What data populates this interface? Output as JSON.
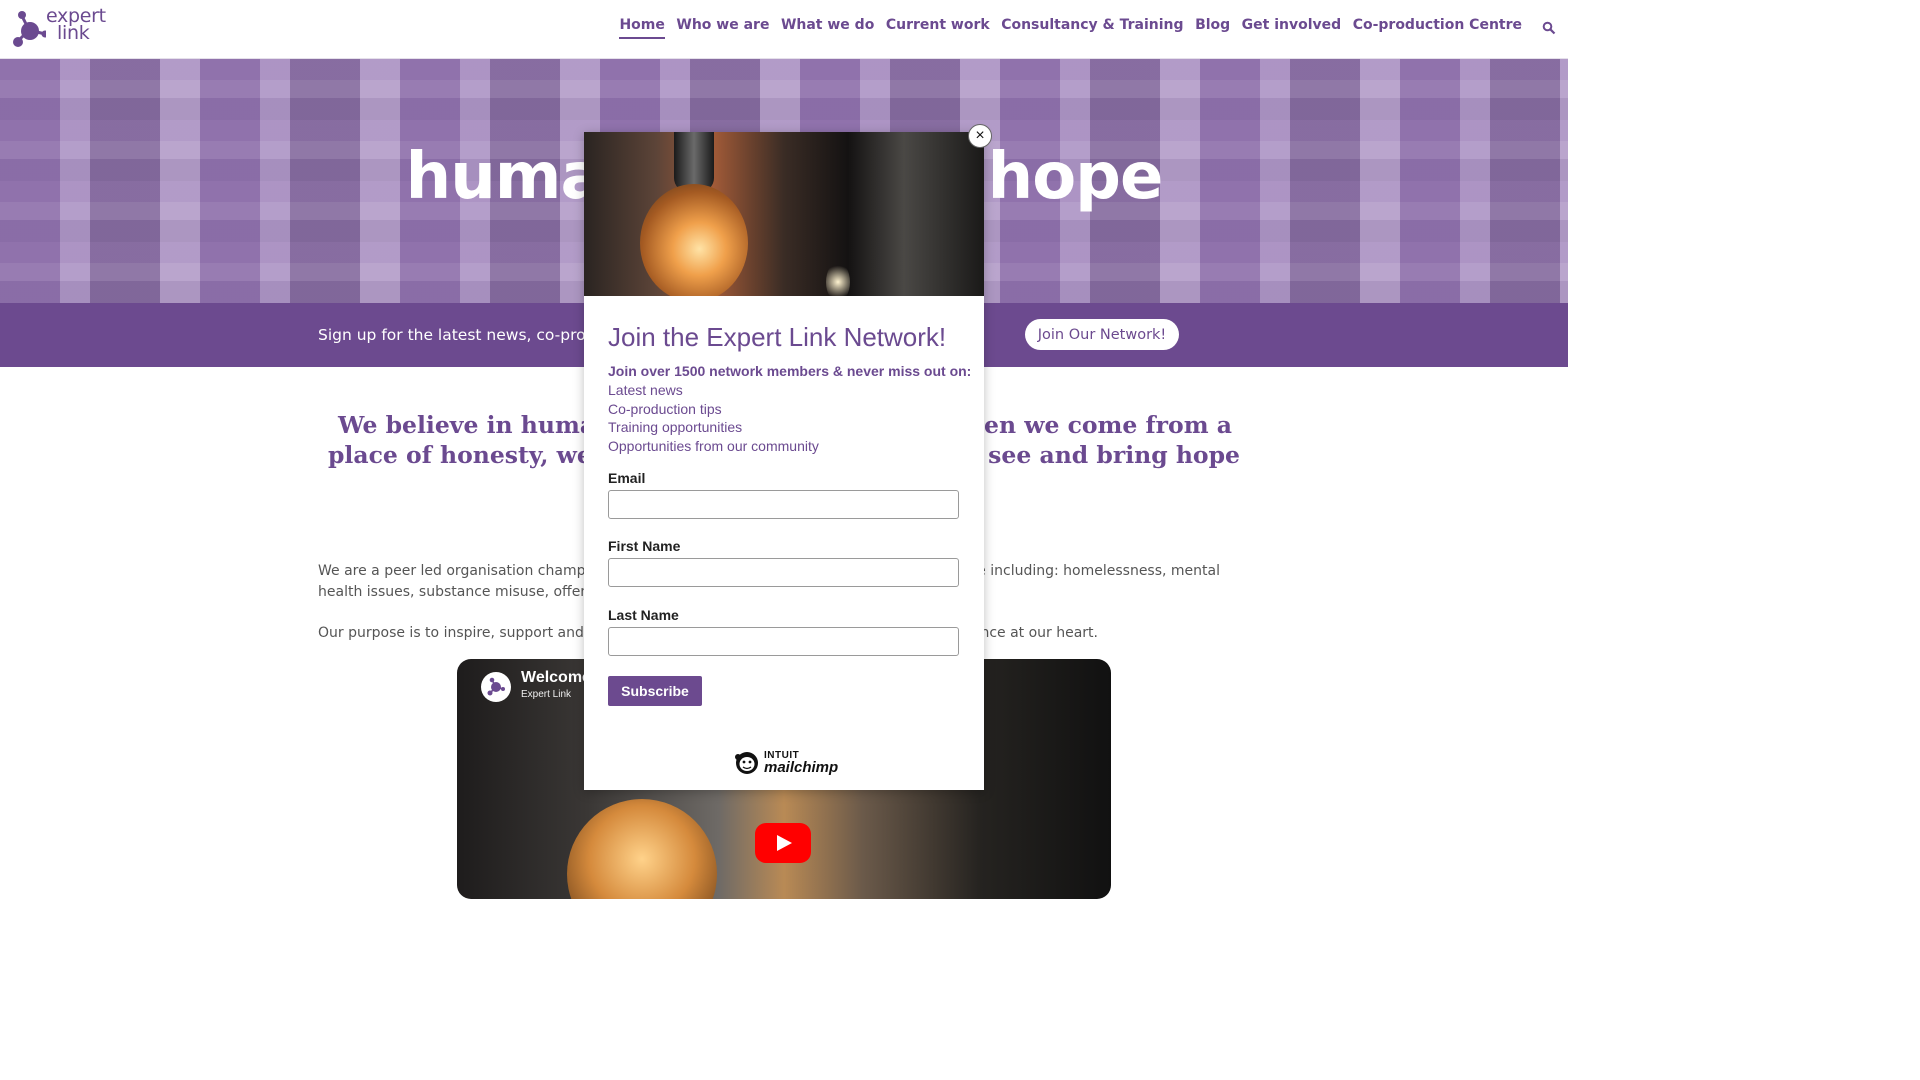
{
  "header": {
    "logo_line1": "expert",
    "logo_line2": "link",
    "nav": [
      {
        "label": "Home",
        "active": true
      },
      {
        "label": "Who we are"
      },
      {
        "label": "What we do"
      },
      {
        "label": "Current work"
      },
      {
        "label": "Consultancy & Training"
      },
      {
        "label": "Blog"
      },
      {
        "label": "Get involved"
      },
      {
        "label": "Co-production Centre"
      }
    ],
    "search_icon": "search-icon"
  },
  "hero": {
    "title_left": "huma",
    "title_right": "hope"
  },
  "banner": {
    "text": "Sign up for the latest news, co-producti",
    "button": "Join Our Network!"
  },
  "main": {
    "belief_line1_left": "We believe in humani",
    "belief_line1_right": "When we come from a",
    "belief_line2_left": "place of honesty, we c",
    "belief_line2_right": "to see and bring hope",
    "para1_left": "We are a peer led organisation championi",
    "para1_right": "tage including: homelessness, mental",
    "para1_line2": "health issues, substance misuse, offending",
    "para2_left": "Our purpose is to inspire, support and cha",
    "para2_right": "ience at our heart."
  },
  "video": {
    "title": "Welcome",
    "channel": "Expert Link"
  },
  "modal": {
    "title": "Join the Expert Link Network!",
    "lead": "Join over 1500 network members & never miss out on:",
    "list": [
      "Latest news",
      "Co-production tips",
      "Training opportunities",
      "Opportunities from our community"
    ],
    "email_label": "Email",
    "first_name_label": "First Name",
    "last_name_label": "Last Name",
    "subscribe": "Subscribe",
    "close": "×",
    "mc_line1": "INTUIT",
    "mc_line2": "mailchimp"
  },
  "colors": {
    "brand_purple": "#6c4a8f",
    "youtube_red": "#ff0000"
  }
}
